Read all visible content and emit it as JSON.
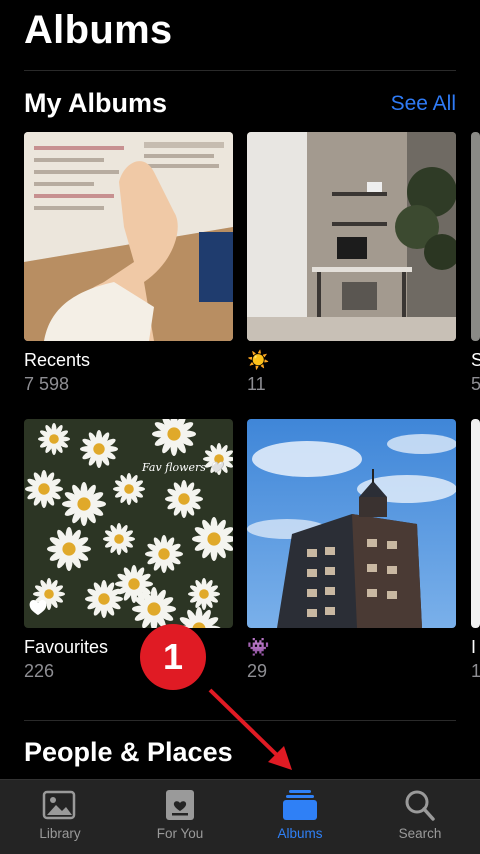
{
  "header": {
    "title": "Albums"
  },
  "my_albums": {
    "title": "My Albums",
    "see_all": "See All",
    "items": [
      {
        "name": "Recents",
        "count": "7 598"
      },
      {
        "name": "☀️",
        "count": "11"
      },
      {
        "name": "S",
        "count": "5"
      },
      {
        "name": "Favourites",
        "count": "226"
      },
      {
        "name": "👾",
        "count": "29"
      },
      {
        "name": "I",
        "count": "1"
      }
    ],
    "photo_text": {
      "daisies_caption": "Fav flowers 🤍"
    }
  },
  "people_places": {
    "title": "People & Places"
  },
  "annotation": {
    "step": "1",
    "color": "#e01b24"
  },
  "tabs": [
    {
      "label": "Library",
      "icon": "photo-library-icon",
      "active": false
    },
    {
      "label": "For You",
      "icon": "for-you-icon",
      "active": false
    },
    {
      "label": "Albums",
      "icon": "albums-stack-icon",
      "active": true
    },
    {
      "label": "Search",
      "icon": "magnifier-icon",
      "active": false
    }
  ],
  "colors": {
    "accent": "#2f7bf6",
    "background": "#000000",
    "tabbar": "#242424"
  }
}
